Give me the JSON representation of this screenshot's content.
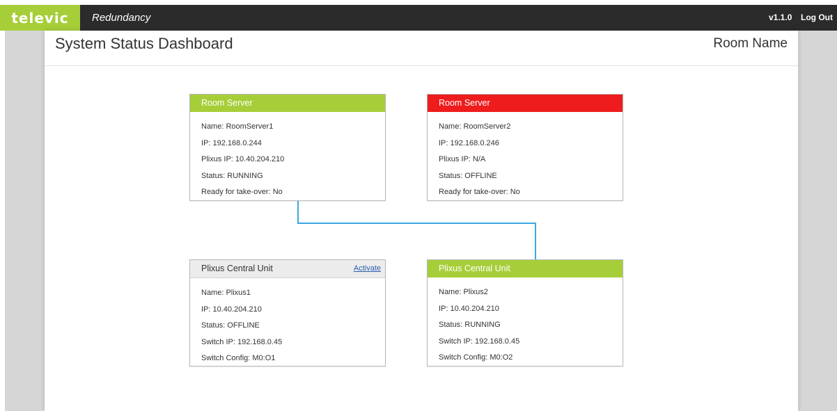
{
  "navbar": {
    "logo": "televic",
    "app_title": "Redundancy",
    "version": "v1.1.0",
    "logout_label": "Log Out"
  },
  "header": {
    "page_title": "System Status Dashboard",
    "room_name": "Room Name"
  },
  "colors": {
    "accent_green": "#a6ce39",
    "status_red": "#ee1c1c",
    "connector": "#3aa8e0"
  },
  "servers": [
    {
      "title": "Room Server",
      "status_color": "green",
      "rows": [
        "Name: RoomServer1",
        "IP: 192.168.0.244",
        "Plixus IP: 10.40.204.210",
        "Status: RUNNING",
        "Ready for take-over: No"
      ]
    },
    {
      "title": "Room Server",
      "status_color": "red",
      "rows": [
        "Name: RoomServer2",
        "IP: 192.168.0.246",
        "Plixus IP: N/A",
        "Status: OFFLINE",
        "Ready for take-over: No"
      ]
    }
  ],
  "units": [
    {
      "title": "Plixus Central Unit",
      "status_color": "gray",
      "action_label": "Activate",
      "rows": [
        "Name: Plixus1",
        "IP: 10.40.204.210",
        "Status: OFFLINE",
        "Switch IP: 192.168.0.45",
        "Switch Config: M0:O1"
      ]
    },
    {
      "title": "Plixus Central Unit",
      "status_color": "green",
      "rows": [
        "Name: Plixus2",
        "IP: 10.40.204.210",
        "Status: RUNNING",
        "Switch IP: 192.168.0.45",
        "Switch Config: M0:O2"
      ]
    }
  ]
}
